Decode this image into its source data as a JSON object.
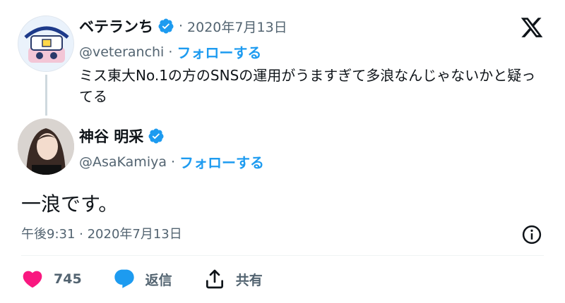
{
  "parent_tweet": {
    "author_name": "ベテランち",
    "date": "2020年7月13日",
    "handle": "@veteranchi",
    "follow_label": "フォローする",
    "text": "ミス東大No.1の方のSNSの運用がうますぎて多浪なんじゃないかと疑ってる"
  },
  "reply_tweet": {
    "author_name": "神谷 明采",
    "handle": "@AsaKamiya",
    "follow_label": "フォローする",
    "text": "一浪です。",
    "timestamp": "午後9:31 · 2020年7月13日"
  },
  "separator": "·",
  "actions": {
    "like_count": "745",
    "reply_label": "返信",
    "share_label": "共有"
  },
  "colors": {
    "accent": "#1d9bf0",
    "like": "#f91880",
    "text_primary": "#0f1419",
    "text_secondary": "#536471"
  },
  "icons": {
    "logo": "x-logo-icon",
    "verified": "verified-badge-icon",
    "info": "info-icon",
    "like": "heart-icon",
    "reply": "speech-bubble-icon",
    "share": "share-upload-icon"
  }
}
